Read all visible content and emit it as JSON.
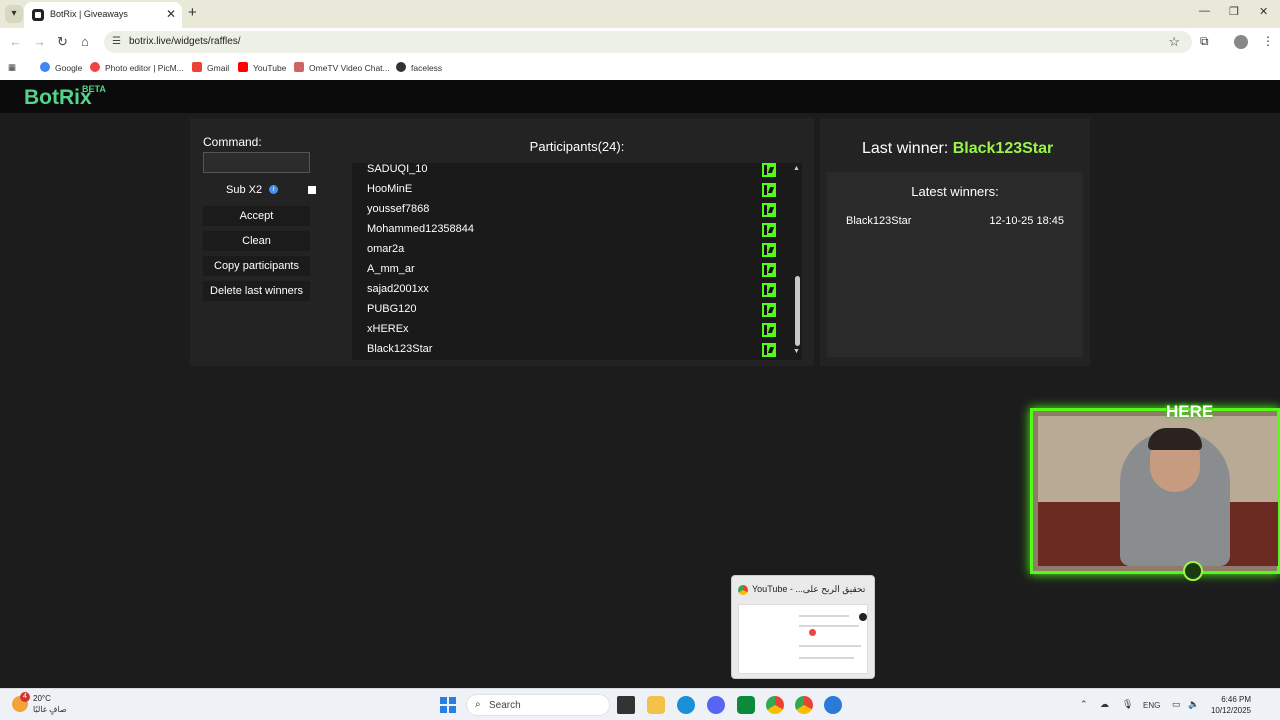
{
  "browser": {
    "tab_title": "BotRix | Giveaways",
    "url": "botrix.live/widgets/raffles/",
    "bookmarks": [
      "Google",
      "Photo editor | PicM...",
      "Gmail",
      "YouTube",
      "OmeTV Video Chat...",
      "faceless"
    ]
  },
  "site": {
    "logo": "BotRix",
    "beta": "BETA"
  },
  "controls": {
    "command_label": "Command:",
    "command_value": "",
    "sub_label": "Sub X2",
    "accept": "Accept",
    "clean": "Clean",
    "copy": "Copy participants",
    "delete": "Delete last winners"
  },
  "participants": {
    "title": "Participants(24):",
    "items": [
      "SADUQI_10",
      "HooMinE",
      "youssef7868",
      "Mohammed12358844",
      "omar2a",
      "A_mm_ar",
      "sajad2001xx",
      "PUBG120",
      "xHEREx",
      "Black123Star"
    ]
  },
  "winner_panel": {
    "last_winner_label": "Last winner:",
    "last_winner": "Black123Star",
    "latest_title": "Latest winners:",
    "latest": [
      {
        "name": "Black123Star",
        "date": "12-10-25 18:45"
      }
    ]
  },
  "cam": {
    "label": "HERE"
  },
  "preview": {
    "title": "YouTube - ...تحقيق الربح على"
  },
  "taskbar": {
    "temp": "20°C",
    "weather_text": "صافٍ غالبًا",
    "weather_badge": "4",
    "search_placeholder": "Search",
    "lang": "ENG",
    "time": "6:46 PM",
    "date": "10/12/2025"
  },
  "colors": {
    "accent": "#53d48a",
    "kick_green": "#53fc18",
    "winner_green": "#9bf548"
  }
}
